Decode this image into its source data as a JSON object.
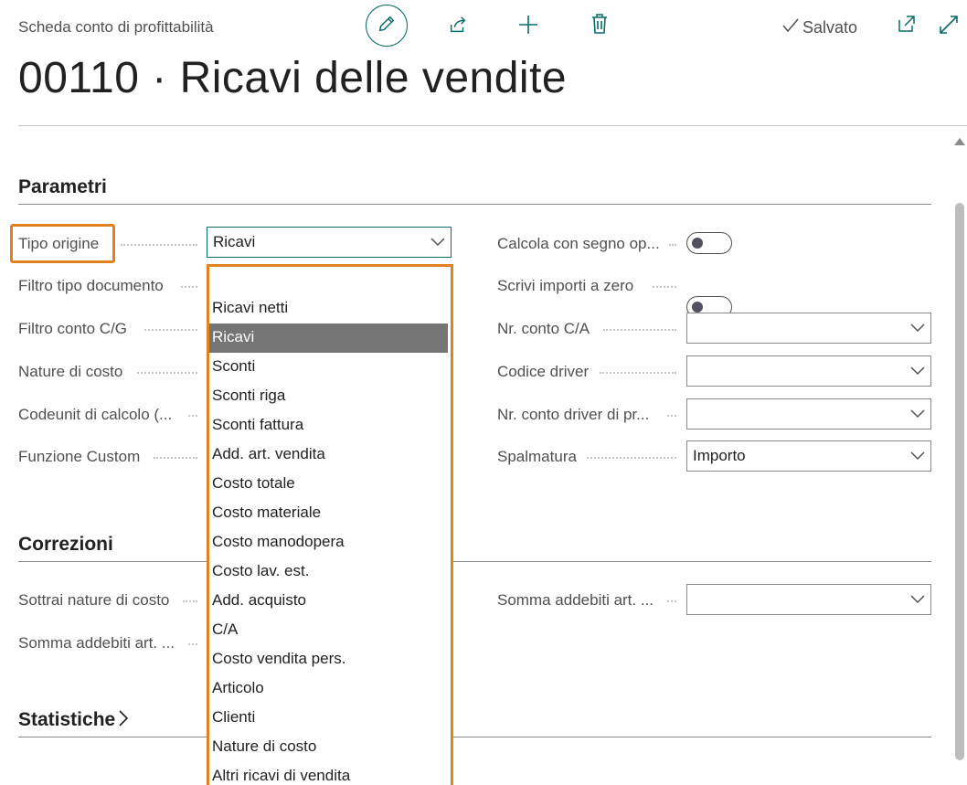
{
  "header": {
    "breadcrumb": "Scheda conto di profittabilità",
    "saved_label": "Salvato",
    "title": "00110 · Ricavi delle vendite"
  },
  "sections": {
    "parametri": "Parametri",
    "correzioni": "Correzioni",
    "statistiche": "Statistiche"
  },
  "parametri": {
    "tipo_origine": {
      "label": "Tipo origine",
      "value": "Ricavi"
    },
    "filtro_tipo_documento": {
      "label": "Filtro tipo documento"
    },
    "filtro_conto_cg": {
      "label": "Filtro conto C/G"
    },
    "nature_di_costo": {
      "label": "Nature di costo"
    },
    "codeunit_calcolo": {
      "label": "Codeunit di calcolo (..."
    },
    "funzione_custom": {
      "label": "Funzione Custom"
    },
    "calcola_segno": {
      "label": "Calcola con segno op...",
      "value": "off"
    },
    "scrivi_importi": {
      "label": "Scrivi importi a zero",
      "value": "off"
    },
    "nr_conto_ca": {
      "label": "Nr. conto C/A",
      "value": ""
    },
    "codice_driver": {
      "label": "Codice driver",
      "value": ""
    },
    "nr_conto_driver": {
      "label": "Nr. conto driver di pr...",
      "value": ""
    },
    "spalmatura": {
      "label": "Spalmatura",
      "value": "Importo"
    }
  },
  "correzioni": {
    "sottrai_nature": {
      "label": "Sottrai nature di costo"
    },
    "somma_addebiti_left": {
      "label": "Somma addebiti art. ..."
    },
    "somma_addebiti_right": {
      "label": "Somma addebiti art. ...",
      "value": ""
    }
  },
  "dropdown": {
    "selected": "Ricavi",
    "options": [
      "Ricavi netti",
      "Ricavi",
      "Sconti",
      "Sconti riga",
      "Sconti fattura",
      "Add. art. vendita",
      "Costo totale",
      "Costo materiale",
      "Costo manodopera",
      "Costo lav. est.",
      "Add. acquisto",
      "C/A",
      "Costo vendita pers.",
      "Articolo",
      "Clienti",
      "Nature di costo",
      "Altri ricavi di vendita"
    ]
  },
  "colors": {
    "accent": "#0b6a6a",
    "highlight": "#e2821e",
    "selected_bg": "#757575"
  }
}
